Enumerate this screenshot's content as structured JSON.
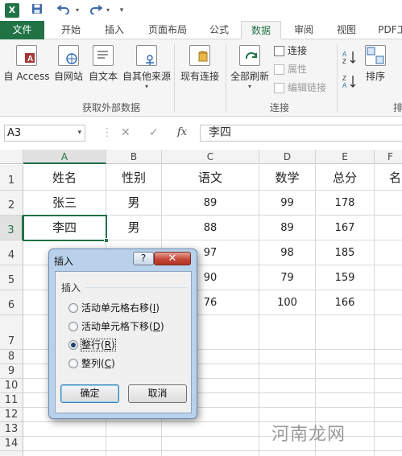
{
  "quick_access": {
    "excel_logo_text": "X",
    "save_icon": "save-icon",
    "undo_icon": "undo-icon",
    "redo_icon": "redo-icon",
    "customize_icon": "customize-qat-icon"
  },
  "tabs": [
    {
      "label": "文件"
    },
    {
      "label": "开始"
    },
    {
      "label": "插入"
    },
    {
      "label": "页面布局"
    },
    {
      "label": "公式"
    },
    {
      "label": "数据"
    },
    {
      "label": "审阅"
    },
    {
      "label": "视图"
    },
    {
      "label": "PDF工"
    }
  ],
  "ribbon": {
    "external_data": {
      "buttons": [
        {
          "label": "自 Access",
          "icon": "access-db-icon"
        },
        {
          "label": "自网站",
          "icon": "web-icon"
        },
        {
          "label": "自文本",
          "icon": "text-file-icon"
        },
        {
          "label": "自其他来源",
          "icon": "other-sources-icon"
        }
      ],
      "group_label": "获取外部数据"
    },
    "existing_connections": {
      "label": "现有连接",
      "icon": "existing-connections-icon"
    },
    "connections": {
      "refresh_all": "全部刷新",
      "connections_item": "连接",
      "properties_item": "属性",
      "edit_links_item": "编辑链接",
      "group_label": "连接"
    },
    "sort": {
      "sort_label": "排序",
      "group_label_partial": "排"
    }
  },
  "formula_bar": {
    "name_box": "A3",
    "cancel_symbol": "✕",
    "enter_symbol": "✓",
    "fx_label": "fx",
    "content": "李四"
  },
  "sheet": {
    "columns": [
      "A",
      "B",
      "C",
      "D",
      "E",
      "F"
    ],
    "rows": [
      "1",
      "2",
      "3",
      "4",
      "5",
      "6",
      "7",
      "8",
      "9",
      "10",
      "11",
      "12",
      "13",
      "14"
    ],
    "headers": [
      "姓名",
      "性别",
      "语文",
      "数学",
      "总分",
      "名"
    ],
    "data": [
      [
        "张三",
        "男",
        "89",
        "99",
        "178"
      ],
      [
        "李四",
        "男",
        "88",
        "89",
        "167"
      ],
      [
        "",
        "",
        "97",
        "98",
        "185"
      ],
      [
        "",
        "",
        "90",
        "79",
        "159"
      ],
      [
        "",
        "",
        "76",
        "100",
        "166"
      ]
    ],
    "active_cell": "A3"
  },
  "dialog": {
    "title": "插入",
    "help_label": "?",
    "close_label": "✕",
    "group_label": "插入",
    "options": [
      {
        "text": "活动单元格右移(",
        "key": "I",
        "tail": ")",
        "checked": false
      },
      {
        "text": "活动单元格下移(",
        "key": "D",
        "tail": ")",
        "checked": false
      },
      {
        "text": "整行(",
        "key": "R",
        "tail": ")",
        "checked": true
      },
      {
        "text": "整列(",
        "key": "C",
        "tail": ")",
        "checked": false
      }
    ],
    "ok_label": "确定",
    "cancel_label": "取消"
  },
  "watermark": "河南龙网",
  "colors": {
    "excel_green": "#217346",
    "dialog_frame": "#b9d1ea",
    "close_red": "#c4473a"
  }
}
